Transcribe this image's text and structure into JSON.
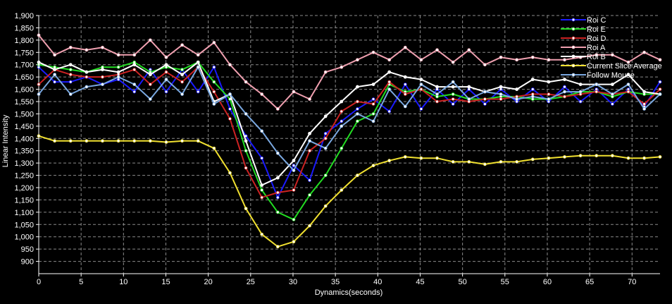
{
  "chart_data": {
    "type": "line",
    "xlabel": "Dynamics(seconds)",
    "ylabel": "Linear Intensity",
    "xlim": [
      0,
      73.3
    ],
    "ylim": [
      850,
      1900
    ],
    "xticks": [
      0,
      5,
      10,
      15,
      20,
      25,
      30,
      35,
      40,
      45,
      50,
      55,
      60,
      65,
      70
    ],
    "yticks": [
      900,
      950,
      1000,
      1050,
      1100,
      1150,
      1200,
      1250,
      1300,
      1350,
      1400,
      1450,
      1500,
      1550,
      1600,
      1650,
      1700,
      1750,
      1800,
      1850,
      1900
    ],
    "grid": true,
    "legend_position": "top-right",
    "x": [
      0,
      1.88,
      3.76,
      5.64,
      7.52,
      9.4,
      11.28,
      13.16,
      15.04,
      16.92,
      18.8,
      20.68,
      22.56,
      24.44,
      26.32,
      28.2,
      30.08,
      31.96,
      33.84,
      35.72,
      37.6,
      39.48,
      41.36,
      43.24,
      45.12,
      47,
      48.88,
      50.76,
      52.64,
      54.52,
      56.4,
      58.28,
      60.16,
      62.04,
      63.92,
      65.8,
      67.68,
      69.56,
      71.44,
      73.3
    ],
    "series": [
      {
        "name": "Roi C",
        "color": "#1a1aff",
        "values": [
          1690,
          1630,
          1630,
          1650,
          1620,
          1640,
          1590,
          1680,
          1590,
          1680,
          1590,
          1690,
          1520,
          1410,
          1320,
          1160,
          1290,
          1230,
          1420,
          1470,
          1520,
          1560,
          1510,
          1620,
          1520,
          1600,
          1540,
          1600,
          1540,
          1600,
          1550,
          1600,
          1550,
          1610,
          1550,
          1600,
          1540,
          1600,
          1530,
          1630
        ]
      },
      {
        "name": "Roi E",
        "color": "#22dd22",
        "values": [
          1700,
          1690,
          1680,
          1670,
          1690,
          1690,
          1710,
          1670,
          1690,
          1680,
          1710,
          1630,
          1560,
          1350,
          1190,
          1100,
          1070,
          1170,
          1250,
          1360,
          1470,
          1500,
          1620,
          1590,
          1600,
          1570,
          1580,
          1560,
          1560,
          1570,
          1570,
          1560,
          1560,
          1570,
          1590,
          1590,
          1570,
          1590,
          1580,
          1580
        ]
      },
      {
        "name": "Roi D",
        "color": "#cc2222",
        "values": [
          1620,
          1680,
          1660,
          1650,
          1650,
          1660,
          1680,
          1620,
          1670,
          1630,
          1690,
          1590,
          1480,
          1280,
          1160,
          1180,
          1190,
          1350,
          1400,
          1510,
          1550,
          1540,
          1630,
          1580,
          1600,
          1550,
          1560,
          1550,
          1560,
          1560,
          1570,
          1580,
          1580,
          1570,
          1580,
          1590,
          1580,
          1590,
          1540,
          1600
        ]
      },
      {
        "name": "Roi A",
        "color": "#f0a0b0",
        "values": [
          1820,
          1740,
          1770,
          1760,
          1770,
          1740,
          1740,
          1800,
          1730,
          1780,
          1740,
          1790,
          1700,
          1630,
          1580,
          1520,
          1590,
          1560,
          1670,
          1690,
          1720,
          1750,
          1720,
          1770,
          1720,
          1760,
          1710,
          1760,
          1700,
          1730,
          1720,
          1730,
          1720,
          1720,
          1730,
          1740,
          1740,
          1710,
          1750,
          1720
        ]
      },
      {
        "name": "Roi B",
        "color": "#ffffff",
        "values": [
          1710,
          1680,
          1700,
          1670,
          1680,
          1670,
          1700,
          1660,
          1700,
          1660,
          1710,
          1550,
          1580,
          1390,
          1210,
          1240,
          1310,
          1420,
          1490,
          1550,
          1610,
          1620,
          1670,
          1650,
          1640,
          1610,
          1610,
          1610,
          1590,
          1610,
          1600,
          1640,
          1630,
          1640,
          1620,
          1620,
          1620,
          1660,
          1590,
          1580
        ]
      },
      {
        "name": "Current Slice Average",
        "color": "#f0e030",
        "values": [
          1410,
          1390,
          1390,
          1390,
          1390,
          1390,
          1390,
          1390,
          1385,
          1390,
          1390,
          1360,
          1260,
          1115,
          1010,
          960,
          980,
          1045,
          1125,
          1190,
          1250,
          1290,
          1310,
          1325,
          1320,
          1320,
          1305,
          1305,
          1295,
          1305,
          1305,
          1315,
          1320,
          1325,
          1330,
          1330,
          1330,
          1320,
          1320,
          1325
        ]
      },
      {
        "name": "Follow Mouse",
        "color": "#7aa8e0",
        "values": [
          1580,
          1660,
          1580,
          1610,
          1620,
          1650,
          1620,
          1560,
          1640,
          1580,
          1690,
          1540,
          1580,
          1500,
          1430,
          1340,
          1270,
          1390,
          1360,
          1450,
          1500,
          1470,
          1600,
          1530,
          1620,
          1580,
          1630,
          1560,
          1590,
          1580,
          1560,
          1570,
          1560,
          1590,
          1590,
          1620,
          1580,
          1620,
          1520,
          1580
        ]
      }
    ]
  }
}
